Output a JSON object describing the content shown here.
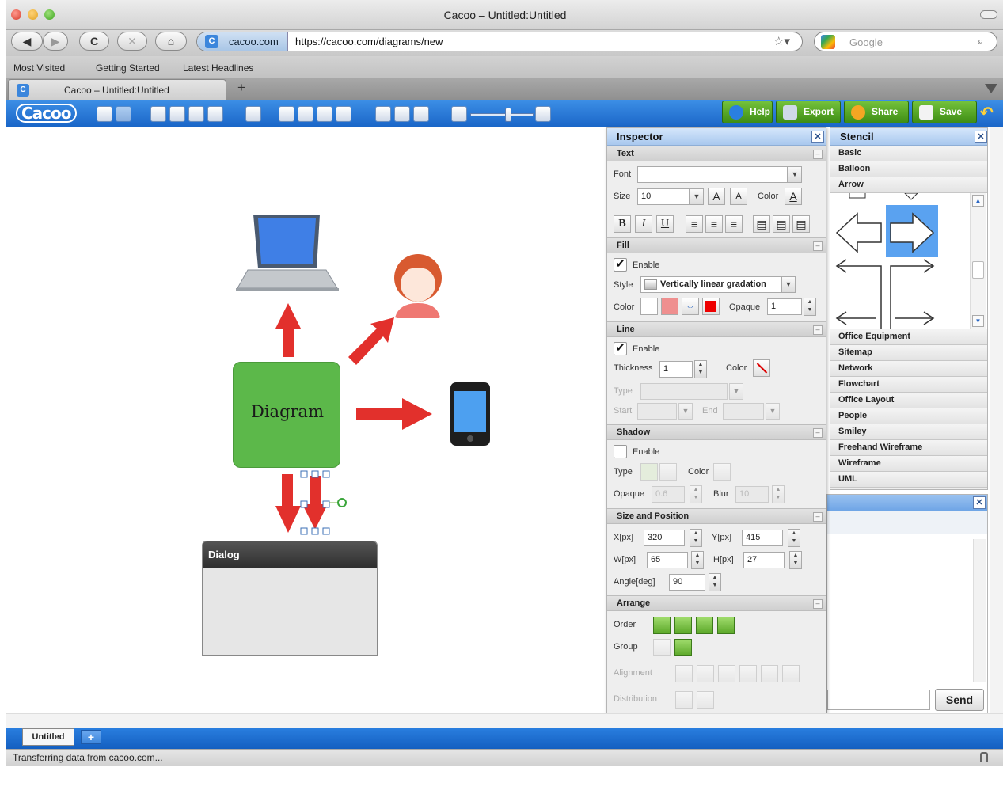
{
  "window": {
    "title": "Cacoo – Untitled:Untitled"
  },
  "nav": {
    "back": "◀",
    "forward": "▶",
    "reload": "C",
    "stop": "✕",
    "home": "⌂",
    "site_label": "cacoo.com",
    "url": "https://cacoo.com/diagrams/new",
    "search_placeholder": "Google"
  },
  "bookmarks": [
    "Most Visited",
    "Getting Started",
    "Latest Headlines"
  ],
  "tab": {
    "label": "Cacoo – Untitled:Untitled",
    "new_tab": "+"
  },
  "toolbar": {
    "logo": "Cacoo",
    "help": "Help",
    "export": "Export",
    "share": "Share",
    "save": "Save"
  },
  "canvas": {
    "diagram_label": "Diagram",
    "dialog_title": "Dialog",
    "colors": {
      "diagram_fill": "#5cb84a",
      "arrow": "#e2302c",
      "selection": "#7ab648"
    }
  },
  "inspector": {
    "title": "Inspector",
    "text": {
      "header": "Text",
      "font_label": "Font",
      "font_value": "",
      "size_label": "Size",
      "size_value": "10",
      "color_label": "Color",
      "bold": "B",
      "italic": "I",
      "underline": "U",
      "grow": "A",
      "shrink": "A",
      "color_glyph": "A"
    },
    "fill": {
      "header": "Fill",
      "enable_label": "Enable",
      "style_label": "Style",
      "style_value": "Vertically linear gradation",
      "color_label": "Color",
      "opaque_label": "Opaque",
      "opaque_value": "1"
    },
    "line": {
      "header": "Line",
      "enable_label": "Enable",
      "thickness_label": "Thickness",
      "thickness_value": "1",
      "color_label": "Color",
      "type_label": "Type",
      "start_label": "Start",
      "end_label": "End"
    },
    "shadow": {
      "header": "Shadow",
      "enable_label": "Enable",
      "type_label": "Type",
      "color_label": "Color",
      "opaque_label": "Opaque",
      "opaque_value": "0.6",
      "blur_label": "Blur",
      "blur_value": "10"
    },
    "size_position": {
      "header": "Size and Position",
      "x_label": "X[px]",
      "x_value": "320",
      "y_label": "Y[px]",
      "y_value": "415",
      "w_label": "W[px]",
      "w_value": "65",
      "h_label": "H[px]",
      "h_value": "27",
      "angle_label": "Angle[deg]",
      "angle_value": "90"
    },
    "arrange": {
      "header": "Arrange",
      "order_label": "Order",
      "group_label": "Group",
      "alignment_label": "Alignment",
      "distribution_label": "Distribution"
    }
  },
  "stencil": {
    "title": "Stencil",
    "categories_top": [
      "Basic",
      "Balloon",
      "Arrow"
    ],
    "categories_bottom": [
      "Office Equipment",
      "Sitemap",
      "Network",
      "Flowchart",
      "Office Layout",
      "People",
      "Smiley",
      "Freehand Wireframe",
      "Wireframe",
      "UML"
    ]
  },
  "chat": {
    "send_label": "Send",
    "input_value": ""
  },
  "pages": {
    "tab_label": "Untitled",
    "add": "+"
  },
  "status": {
    "text": "Transferring data from cacoo.com..."
  }
}
